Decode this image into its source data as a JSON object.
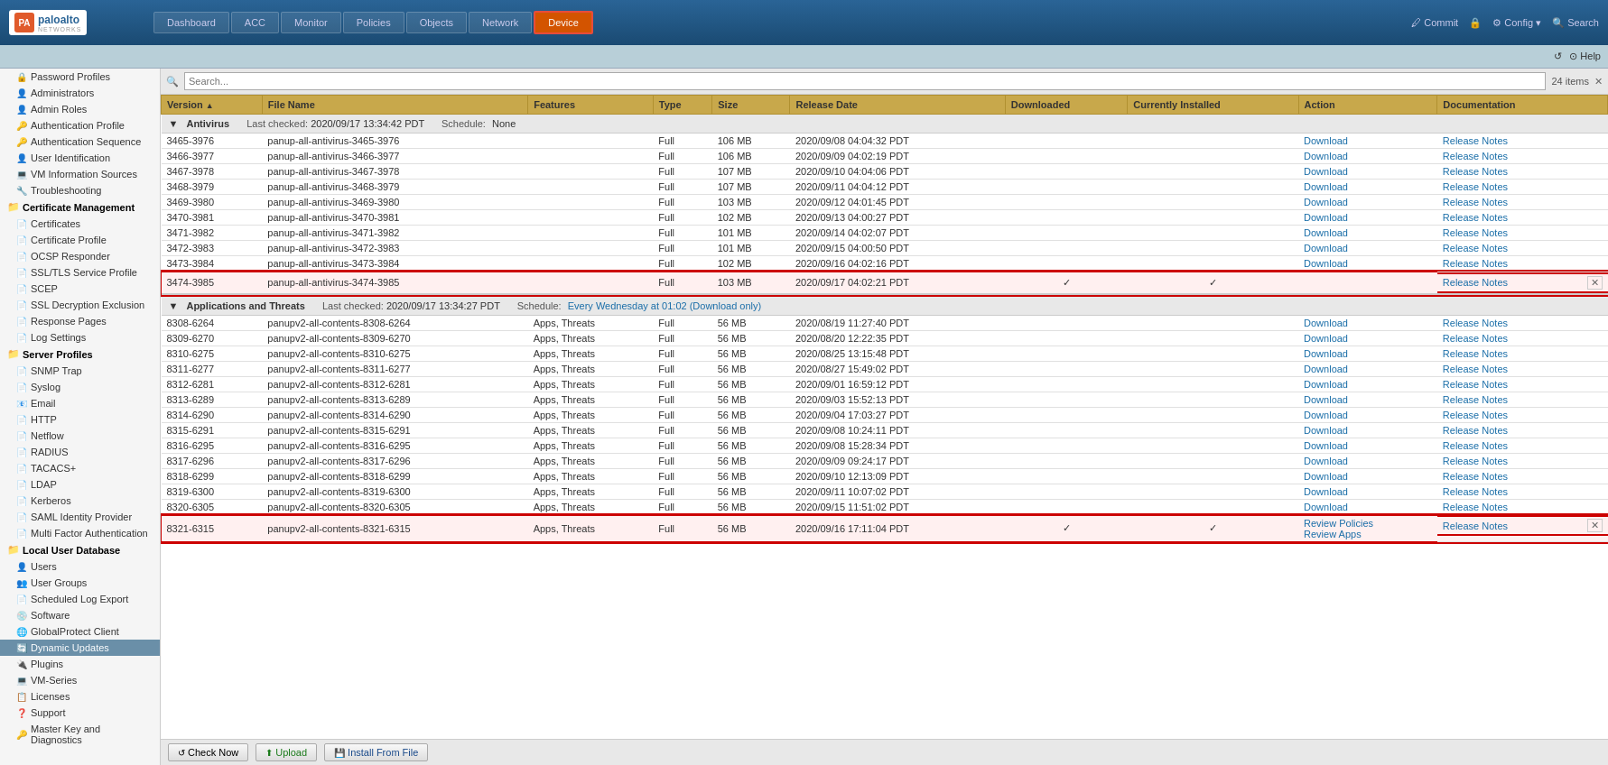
{
  "app": {
    "title": "Palo Alto Networks",
    "logo_text": "paloalto",
    "logo_sub": "NETWORKS"
  },
  "topnav": {
    "tabs": [
      {
        "id": "dashboard",
        "label": "Dashboard",
        "active": false
      },
      {
        "id": "acc",
        "label": "ACC",
        "active": false
      },
      {
        "id": "monitor",
        "label": "Monitor",
        "active": false
      },
      {
        "id": "policies",
        "label": "Policies",
        "active": false
      },
      {
        "id": "objects",
        "label": "Objects",
        "active": false
      },
      {
        "id": "network",
        "label": "Network",
        "active": false
      },
      {
        "id": "device",
        "label": "Device",
        "active": true
      }
    ],
    "actions": [
      "Commit",
      "Config",
      "Search"
    ]
  },
  "subbar": {
    "refresh": "↺",
    "help": "Help"
  },
  "sidebar": {
    "items": [
      {
        "id": "password-profiles",
        "label": "Password Profiles",
        "level": 0,
        "icon": "🔒"
      },
      {
        "id": "administrators",
        "label": "Administrators",
        "level": 0,
        "icon": "👤"
      },
      {
        "id": "admin-roles",
        "label": "Admin Roles",
        "level": 0,
        "icon": "👤"
      },
      {
        "id": "auth-profile",
        "label": "Authentication Profile",
        "level": 0,
        "icon": "🔑"
      },
      {
        "id": "auth-sequence",
        "label": "Authentication Sequence",
        "level": 0,
        "icon": "🔑"
      },
      {
        "id": "user-id",
        "label": "User Identification",
        "level": 0,
        "icon": "👤"
      },
      {
        "id": "vm-info",
        "label": "VM Information Sources",
        "level": 0,
        "icon": "💻"
      },
      {
        "id": "troubleshoot",
        "label": "Troubleshooting",
        "level": 0,
        "icon": "🔧"
      },
      {
        "id": "cert-mgmt",
        "label": "Certificate Management",
        "level": 0,
        "icon": "📁",
        "group": true
      },
      {
        "id": "certificates",
        "label": "Certificates",
        "level": 1,
        "icon": "📄"
      },
      {
        "id": "cert-profile",
        "label": "Certificate Profile",
        "level": 1,
        "icon": "📄"
      },
      {
        "id": "ocsp",
        "label": "OCSP Responder",
        "level": 1,
        "icon": "📄"
      },
      {
        "id": "ssl-tls",
        "label": "SSL/TLS Service Profile",
        "level": 1,
        "icon": "📄"
      },
      {
        "id": "scep",
        "label": "SCEP",
        "level": 1,
        "icon": "📄"
      },
      {
        "id": "ssl-decrypt",
        "label": "SSL Decryption Exclusion",
        "level": 1,
        "icon": "📄"
      },
      {
        "id": "response-pages",
        "label": "Response Pages",
        "level": 0,
        "icon": "📄"
      },
      {
        "id": "log-settings",
        "label": "Log Settings",
        "level": 0,
        "icon": "📄"
      },
      {
        "id": "server-profiles",
        "label": "Server Profiles",
        "level": 0,
        "icon": "📁",
        "group": true
      },
      {
        "id": "snmp",
        "label": "SNMP Trap",
        "level": 1,
        "icon": "📄"
      },
      {
        "id": "syslog",
        "label": "Syslog",
        "level": 1,
        "icon": "📄"
      },
      {
        "id": "email",
        "label": "Email",
        "level": 1,
        "icon": "📧"
      },
      {
        "id": "http",
        "label": "HTTP",
        "level": 1,
        "icon": "📄"
      },
      {
        "id": "netflow",
        "label": "Netflow",
        "level": 1,
        "icon": "📄"
      },
      {
        "id": "radius",
        "label": "RADIUS",
        "level": 1,
        "icon": "📄"
      },
      {
        "id": "tacacs",
        "label": "TACACS+",
        "level": 1,
        "icon": "📄"
      },
      {
        "id": "ldap",
        "label": "LDAP",
        "level": 1,
        "icon": "📄"
      },
      {
        "id": "kerberos",
        "label": "Kerberos",
        "level": 1,
        "icon": "📄"
      },
      {
        "id": "saml",
        "label": "SAML Identity Provider",
        "level": 1,
        "icon": "📄"
      },
      {
        "id": "mfa",
        "label": "Multi Factor Authentication",
        "level": 1,
        "icon": "📄"
      },
      {
        "id": "local-user-db",
        "label": "Local User Database",
        "level": 0,
        "icon": "📁",
        "group": true
      },
      {
        "id": "users",
        "label": "Users",
        "level": 1,
        "icon": "👤"
      },
      {
        "id": "user-groups",
        "label": "User Groups",
        "level": 1,
        "icon": "👥"
      },
      {
        "id": "sched-log",
        "label": "Scheduled Log Export",
        "level": 0,
        "icon": "📄"
      },
      {
        "id": "software",
        "label": "Software",
        "level": 0,
        "icon": "💿"
      },
      {
        "id": "gp-client",
        "label": "GlobalProtect Client",
        "level": 0,
        "icon": "🌐"
      },
      {
        "id": "dynamic-updates",
        "label": "Dynamic Updates",
        "level": 0,
        "icon": "🔄",
        "selected": true
      },
      {
        "id": "plugins",
        "label": "Plugins",
        "level": 0,
        "icon": "🔌"
      },
      {
        "id": "vm-series",
        "label": "VM-Series",
        "level": 0,
        "icon": "💻"
      },
      {
        "id": "licenses",
        "label": "Licenses",
        "level": 0,
        "icon": "📋"
      },
      {
        "id": "support",
        "label": "Support",
        "level": 0,
        "icon": "❓"
      },
      {
        "id": "master-key",
        "label": "Master Key and Diagnostics",
        "level": 0,
        "icon": "🔑"
      }
    ]
  },
  "content": {
    "item_count": "24 items",
    "search_placeholder": "Search...",
    "table_headers": [
      "Version",
      "File Name",
      "Features",
      "Type",
      "Size",
      "Release Date",
      "Downloaded",
      "Currently Installed",
      "Action",
      "Documentation"
    ],
    "antivirus_section": {
      "title": "Antivirus",
      "last_checked": "2020/09/17 13:34:42 PDT",
      "schedule_label": "Schedule:",
      "schedule_value": "None",
      "rows": [
        {
          "version": "3465-3976",
          "filename": "panup-all-antivirus-3465-3976",
          "features": "",
          "type": "Full",
          "size": "106 MB",
          "release_date": "2020/09/08 04:04:32 PDT",
          "downloaded": "",
          "installed": "",
          "action": "Download",
          "docs": "Release Notes",
          "highlighted": false
        },
        {
          "version": "3466-3977",
          "filename": "panup-all-antivirus-3466-3977",
          "features": "",
          "type": "Full",
          "size": "106 MB",
          "release_date": "2020/09/09 04:02:19 PDT",
          "downloaded": "",
          "installed": "",
          "action": "Download",
          "docs": "Release Notes",
          "highlighted": false
        },
        {
          "version": "3467-3978",
          "filename": "panup-all-antivirus-3467-3978",
          "features": "",
          "type": "Full",
          "size": "107 MB",
          "release_date": "2020/09/10 04:04:06 PDT",
          "downloaded": "",
          "installed": "",
          "action": "Download",
          "docs": "Release Notes",
          "highlighted": false
        },
        {
          "version": "3468-3979",
          "filename": "panup-all-antivirus-3468-3979",
          "features": "",
          "type": "Full",
          "size": "107 MB",
          "release_date": "2020/09/11 04:04:12 PDT",
          "downloaded": "",
          "installed": "",
          "action": "Download",
          "docs": "Release Notes",
          "highlighted": false
        },
        {
          "version": "3469-3980",
          "filename": "panup-all-antivirus-3469-3980",
          "features": "",
          "type": "Full",
          "size": "103 MB",
          "release_date": "2020/09/12 04:01:45 PDT",
          "downloaded": "",
          "installed": "",
          "action": "Download",
          "docs": "Release Notes",
          "highlighted": false
        },
        {
          "version": "3470-3981",
          "filename": "panup-all-antivirus-3470-3981",
          "features": "",
          "type": "Full",
          "size": "102 MB",
          "release_date": "2020/09/13 04:00:27 PDT",
          "downloaded": "",
          "installed": "",
          "action": "Download",
          "docs": "Release Notes",
          "highlighted": false
        },
        {
          "version": "3471-3982",
          "filename": "panup-all-antivirus-3471-3982",
          "features": "",
          "type": "Full",
          "size": "101 MB",
          "release_date": "2020/09/14 04:02:07 PDT",
          "downloaded": "",
          "installed": "",
          "action": "Download",
          "docs": "Release Notes",
          "highlighted": false
        },
        {
          "version": "3472-3983",
          "filename": "panup-all-antivirus-3472-3983",
          "features": "",
          "type": "Full",
          "size": "101 MB",
          "release_date": "2020/09/15 04:00:50 PDT",
          "downloaded": "",
          "installed": "",
          "action": "Download",
          "docs": "Release Notes",
          "highlighted": false
        },
        {
          "version": "3473-3984",
          "filename": "panup-all-antivirus-3473-3984",
          "features": "",
          "type": "Full",
          "size": "102 MB",
          "release_date": "2020/09/16 04:02:16 PDT",
          "downloaded": "",
          "installed": "",
          "action": "Download",
          "docs": "Release Notes",
          "highlighted": false
        },
        {
          "version": "3474-3985",
          "filename": "panup-all-antivirus-3474-3985",
          "features": "",
          "type": "Full",
          "size": "103 MB",
          "release_date": "2020/09/17 04:02:21 PDT",
          "downloaded": "✓",
          "installed": "✓",
          "action": "",
          "docs": "Release Notes",
          "highlighted": true
        }
      ]
    },
    "appthreat_section": {
      "title": "Applications and Threats",
      "last_checked": "2020/09/17 13:34:27 PDT",
      "schedule_label": "Schedule:",
      "schedule_value": "Every Wednesday at 01:02 (Download only)",
      "rows": [
        {
          "version": "8308-6264",
          "filename": "panupv2-all-contents-8308-6264",
          "features": "Apps, Threats",
          "type": "Full",
          "size": "56 MB",
          "release_date": "2020/08/19 11:27:40 PDT",
          "downloaded": "",
          "installed": "",
          "action": "Download",
          "docs": "Release Notes",
          "highlighted": false
        },
        {
          "version": "8309-6270",
          "filename": "panupv2-all-contents-8309-6270",
          "features": "Apps, Threats",
          "type": "Full",
          "size": "56 MB",
          "release_date": "2020/08/20 12:22:35 PDT",
          "downloaded": "",
          "installed": "",
          "action": "Download",
          "docs": "Release Notes",
          "highlighted": false
        },
        {
          "version": "8310-6275",
          "filename": "panupv2-all-contents-8310-6275",
          "features": "Apps, Threats",
          "type": "Full",
          "size": "56 MB",
          "release_date": "2020/08/25 13:15:48 PDT",
          "downloaded": "",
          "installed": "",
          "action": "Download",
          "docs": "Release Notes",
          "highlighted": false
        },
        {
          "version": "8311-6277",
          "filename": "panupv2-all-contents-8311-6277",
          "features": "Apps, Threats",
          "type": "Full",
          "size": "56 MB",
          "release_date": "2020/08/27 15:49:02 PDT",
          "downloaded": "",
          "installed": "",
          "action": "Download",
          "docs": "Release Notes",
          "highlighted": false
        },
        {
          "version": "8312-6281",
          "filename": "panupv2-all-contents-8312-6281",
          "features": "Apps, Threats",
          "type": "Full",
          "size": "56 MB",
          "release_date": "2020/09/01 16:59:12 PDT",
          "downloaded": "",
          "installed": "",
          "action": "Download",
          "docs": "Release Notes",
          "highlighted": false
        },
        {
          "version": "8313-6289",
          "filename": "panupv2-all-contents-8313-6289",
          "features": "Apps, Threats",
          "type": "Full",
          "size": "56 MB",
          "release_date": "2020/09/03 15:52:13 PDT",
          "downloaded": "",
          "installed": "",
          "action": "Download",
          "docs": "Release Notes",
          "highlighted": false
        },
        {
          "version": "8314-6290",
          "filename": "panupv2-all-contents-8314-6290",
          "features": "Apps, Threats",
          "type": "Full",
          "size": "56 MB",
          "release_date": "2020/09/04 17:03:27 PDT",
          "downloaded": "",
          "installed": "",
          "action": "Download",
          "docs": "Release Notes",
          "highlighted": false
        },
        {
          "version": "8315-6291",
          "filename": "panupv2-all-contents-8315-6291",
          "features": "Apps, Threats",
          "type": "Full",
          "size": "56 MB",
          "release_date": "2020/09/08 10:24:11 PDT",
          "downloaded": "",
          "installed": "",
          "action": "Download",
          "docs": "Release Notes",
          "highlighted": false
        },
        {
          "version": "8316-6295",
          "filename": "panupv2-all-contents-8316-6295",
          "features": "Apps, Threats",
          "type": "Full",
          "size": "56 MB",
          "release_date": "2020/09/08 15:28:34 PDT",
          "downloaded": "",
          "installed": "",
          "action": "Download",
          "docs": "Release Notes",
          "highlighted": false
        },
        {
          "version": "8317-6296",
          "filename": "panupv2-all-contents-8317-6296",
          "features": "Apps, Threats",
          "type": "Full",
          "size": "56 MB",
          "release_date": "2020/09/09 09:24:17 PDT",
          "downloaded": "",
          "installed": "",
          "action": "Download",
          "docs": "Release Notes",
          "highlighted": false
        },
        {
          "version": "8318-6299",
          "filename": "panupv2-all-contents-8318-6299",
          "features": "Apps, Threats",
          "type": "Full",
          "size": "56 MB",
          "release_date": "2020/09/10 12:13:09 PDT",
          "downloaded": "",
          "installed": "",
          "action": "Download",
          "docs": "Release Notes",
          "highlighted": false
        },
        {
          "version": "8319-6300",
          "filename": "panupv2-all-contents-8319-6300",
          "features": "Apps, Threats",
          "type": "Full",
          "size": "56 MB",
          "release_date": "2020/09/11 10:07:02 PDT",
          "downloaded": "",
          "installed": "",
          "action": "Download",
          "docs": "Release Notes",
          "highlighted": false
        },
        {
          "version": "8320-6305",
          "filename": "panupv2-all-contents-8320-6305",
          "features": "Apps, Threats",
          "type": "Full",
          "size": "56 MB",
          "release_date": "2020/09/15 11:51:02 PDT",
          "downloaded": "",
          "installed": "",
          "action": "Download",
          "docs": "Release Notes",
          "highlighted": false
        },
        {
          "version": "8321-6315",
          "filename": "panupv2-all-contents-8321-6315",
          "features": "Apps, Threats",
          "type": "Full",
          "size": "56 MB",
          "release_date": "2020/09/16 17:11:04 PDT",
          "downloaded": "✓",
          "installed": "✓",
          "action1": "Review Policies",
          "action2": "Review Apps",
          "docs": "Release Notes",
          "highlighted": true
        }
      ]
    }
  },
  "bottombar": {
    "check_now": "Check Now",
    "upload": "Upload",
    "install_from_file": "Install From File"
  }
}
